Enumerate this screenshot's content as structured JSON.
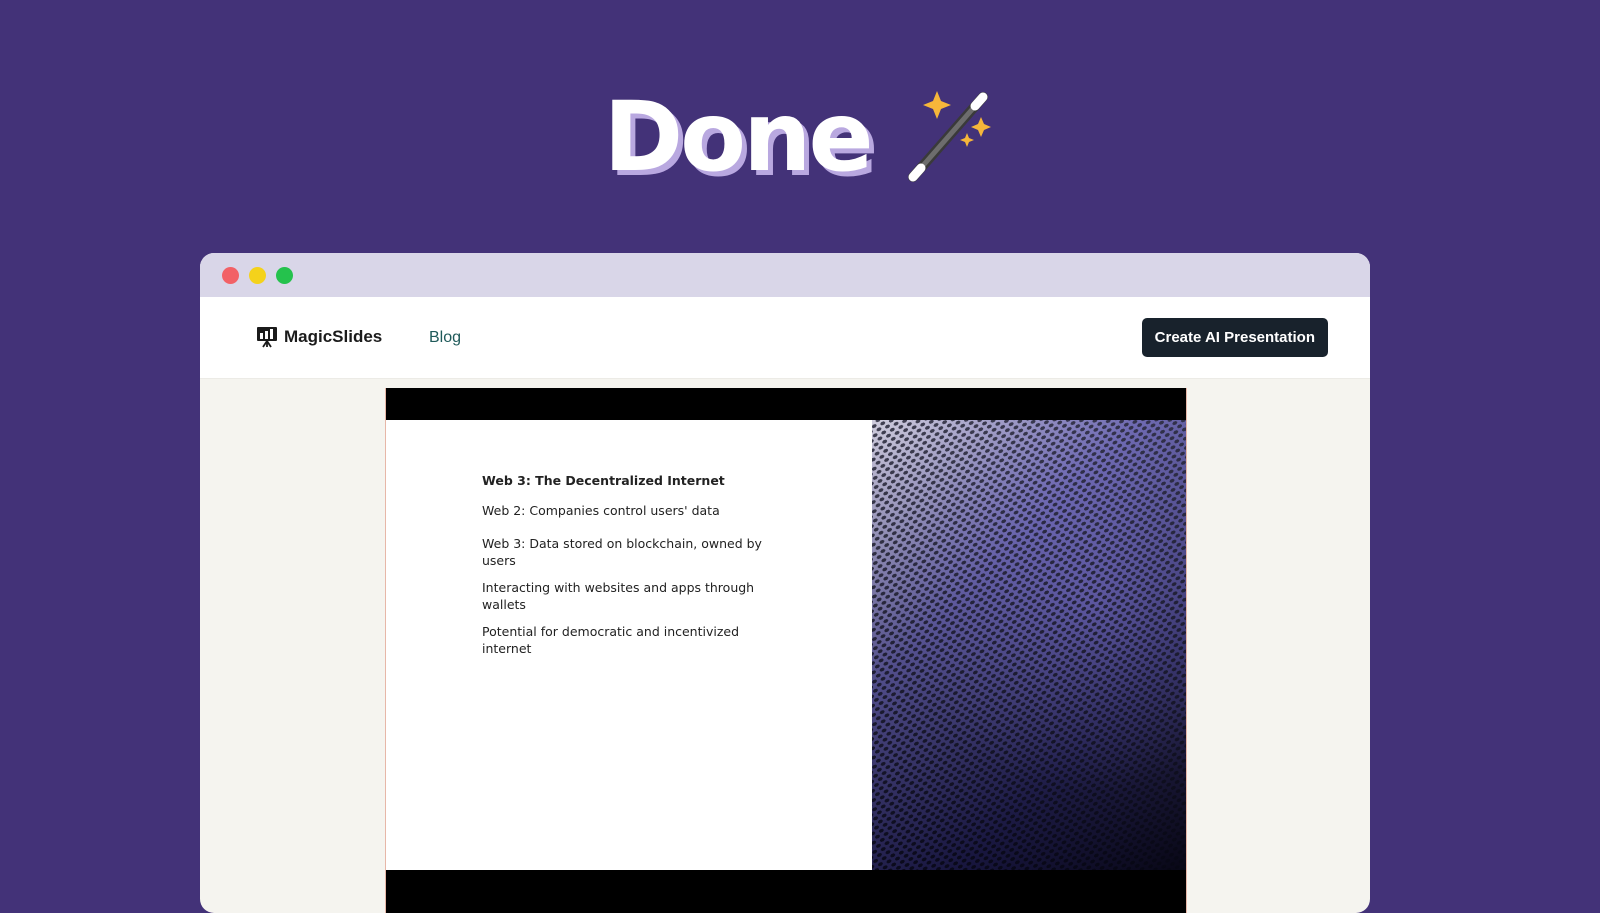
{
  "hero": {
    "title": "Done",
    "icon": "magic-wand-icon"
  },
  "window": {
    "controls": [
      "close",
      "minimize",
      "maximize"
    ]
  },
  "nav": {
    "brand": "MagicSlides",
    "brand_icon": "presentation-board-icon",
    "blog_label": "Blog",
    "cta_label": "Create AI Presentation"
  },
  "slide": {
    "title": "Web 3: The Decentralized Internet",
    "bullets": [
      "Web 2: Companies control users' data",
      "Web 3: Data stored on blockchain, owned by users",
      "Interacting with websites and apps through wallets",
      "Potential for democratic and incentivized internet"
    ],
    "image": "metal-mesh-photo"
  },
  "colors": {
    "background": "#433278",
    "titlebar": "#d9d6e8",
    "cta": "#18222c",
    "link": "#1f5a5a"
  }
}
